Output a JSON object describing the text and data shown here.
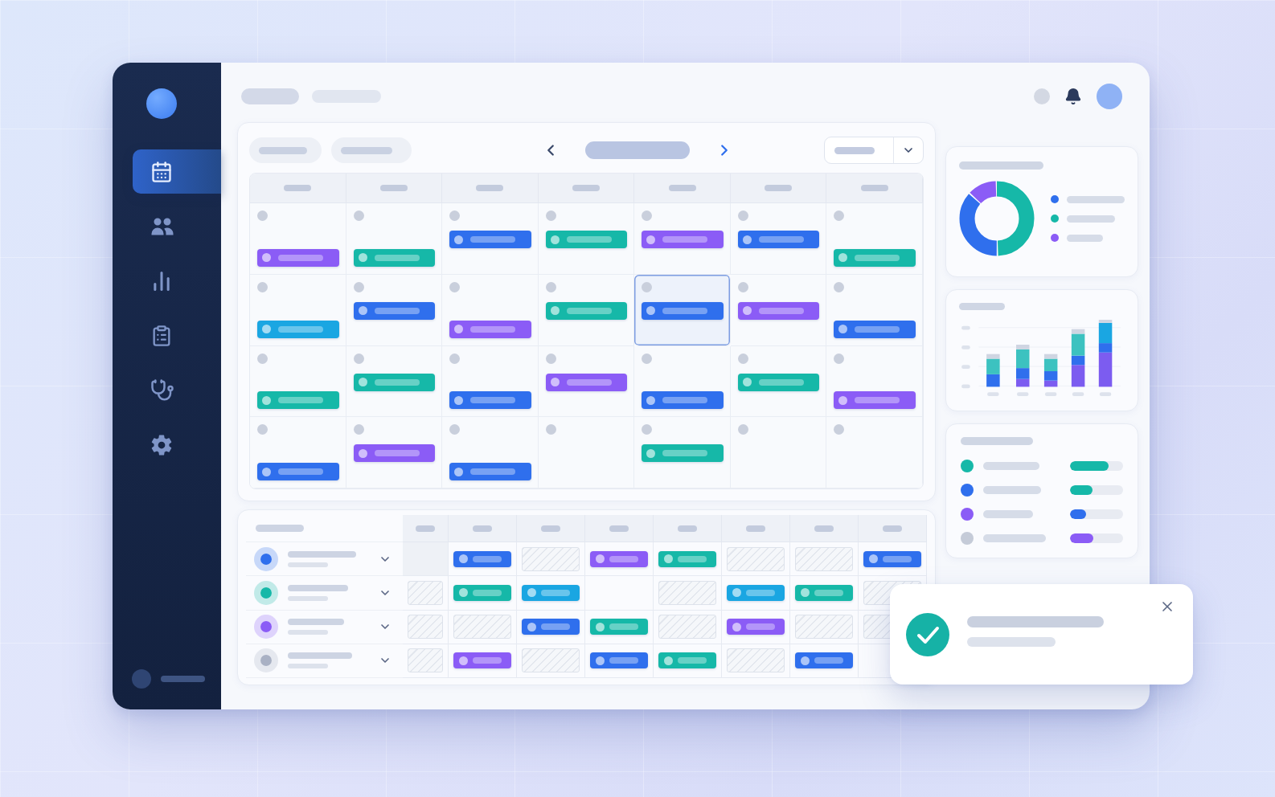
{
  "sidebar": {
    "items": [
      {
        "kind": "calendar",
        "selected": true
      },
      {
        "kind": "people",
        "selected": false
      },
      {
        "kind": "chart",
        "selected": false
      },
      {
        "kind": "clipboard",
        "selected": false
      },
      {
        "kind": "stethoscope",
        "selected": false
      },
      {
        "kind": "settings",
        "selected": false
      }
    ]
  },
  "calendar": {
    "weeks": [
      {
        "days": [
          {
            "selected": false,
            "event": {
              "color": "#8b5cf6",
              "kind": "late"
            }
          },
          {
            "selected": false,
            "event": {
              "color": "#16b8a8",
              "kind": "late"
            }
          },
          {
            "selected": false,
            "event": {
              "color": "#2f6fed",
              "kind": "early"
            }
          },
          {
            "selected": false,
            "event": {
              "color": "#16b8a8",
              "kind": "early"
            }
          },
          {
            "selected": false,
            "event": {
              "color": "#8b5cf6",
              "kind": "early"
            }
          },
          {
            "selected": false,
            "event": {
              "color": "#2f6fed",
              "kind": "early"
            }
          },
          {
            "selected": false,
            "event": {
              "color": "#16b8a8",
              "kind": "late"
            }
          }
        ]
      },
      {
        "days": [
          {
            "selected": false,
            "event": {
              "color": "#1aa6e2",
              "kind": "late"
            }
          },
          {
            "selected": false,
            "event": {
              "color": "#2f6fed",
              "kind": "early"
            }
          },
          {
            "selected": false,
            "event": {
              "color": "#8b5cf6",
              "kind": "late"
            }
          },
          {
            "selected": false,
            "event": {
              "color": "#16b8a8",
              "kind": "early"
            }
          },
          {
            "selected": true,
            "event": {
              "color": "#2f6fed",
              "kind": "early"
            }
          },
          {
            "selected": false,
            "event": {
              "color": "#8b5cf6",
              "kind": "early"
            }
          },
          {
            "selected": false,
            "event": {
              "color": "#2f6fed",
              "kind": "late"
            }
          }
        ]
      },
      {
        "days": [
          {
            "selected": false,
            "event": {
              "color": "#16b8a8",
              "kind": "late"
            }
          },
          {
            "selected": false,
            "event": {
              "color": "#16b8a8",
              "kind": "early"
            }
          },
          {
            "selected": false,
            "event": {
              "color": "#2f6fed",
              "kind": "late"
            }
          },
          {
            "selected": false,
            "event": {
              "color": "#8b5cf6",
              "kind": "early"
            }
          },
          {
            "selected": false,
            "event": {
              "color": "#2f6fed",
              "kind": "late"
            }
          },
          {
            "selected": false,
            "event": {
              "color": "#16b8a8",
              "kind": "early"
            }
          },
          {
            "selected": false,
            "event": {
              "color": "#8b5cf6",
              "kind": "late"
            }
          }
        ]
      },
      {
        "days": [
          {
            "selected": false,
            "event": {
              "color": "#2f6fed",
              "kind": "late"
            }
          },
          {
            "selected": false,
            "event": {
              "color": "#8b5cf6",
              "kind": "early"
            }
          },
          {
            "selected": false,
            "event": {
              "color": "#2f6fed",
              "kind": "late"
            }
          },
          {
            "selected": false
          },
          {
            "selected": false,
            "event": {
              "color": "#16b8a8",
              "kind": "early"
            }
          },
          {
            "selected": false
          },
          {
            "selected": false
          }
        ]
      }
    ]
  },
  "schedule": {
    "rows": [
      {
        "color": "#2f6fed",
        "cells": [
          {
            "kind": "idle"
          },
          {
            "kind": "event",
            "color": "#2f6fed"
          },
          {
            "kind": "blocked"
          },
          {
            "kind": "event",
            "color": "#8b5cf6"
          },
          {
            "kind": "event",
            "color": "#16b8a8"
          },
          {
            "kind": "blocked"
          },
          {
            "kind": "blocked"
          },
          {
            "kind": "event",
            "color": "#2f6fed"
          }
        ]
      },
      {
        "color": "#16b8a8",
        "cells": [
          {
            "kind": "blocked"
          },
          {
            "kind": "event",
            "color": "#16b8a8"
          },
          {
            "kind": "event",
            "color": "#1aa6e2"
          },
          {
            "kind": "empty"
          },
          {
            "kind": "blocked"
          },
          {
            "kind": "event",
            "color": "#1aa6e2"
          },
          {
            "kind": "event",
            "color": "#16b8a8"
          },
          {
            "kind": "blocked"
          }
        ]
      },
      {
        "color": "#8b5cf6",
        "cells": [
          {
            "kind": "blocked"
          },
          {
            "kind": "blocked"
          },
          {
            "kind": "event",
            "color": "#2f6fed"
          },
          {
            "kind": "event",
            "color": "#16b8a8"
          },
          {
            "kind": "blocked"
          },
          {
            "kind": "event",
            "color": "#8b5cf6"
          },
          {
            "kind": "blocked"
          },
          {
            "kind": "blocked"
          }
        ]
      },
      {
        "color": "#a9b1c4",
        "cells": [
          {
            "kind": "blocked"
          },
          {
            "kind": "event",
            "color": "#8b5cf6"
          },
          {
            "kind": "blocked"
          },
          {
            "kind": "event",
            "color": "#2f6fed"
          },
          {
            "kind": "event",
            "color": "#16b8a8"
          },
          {
            "kind": "blocked"
          },
          {
            "kind": "event",
            "color": "#2f6fed"
          },
          {
            "kind": "empty"
          }
        ]
      }
    ]
  },
  "donut_legend": [
    {
      "color": "#2f6fed"
    },
    {
      "color": "#16b8a8"
    },
    {
      "color": "#8b5cf6"
    }
  ],
  "staff": [
    {
      "color": "#16b8a8",
      "meter": {
        "level": 0.72,
        "color": "#16b8a8"
      }
    },
    {
      "color": "#2f6fed",
      "meter": {
        "level": 0.42,
        "color": "#16b8a8"
      }
    },
    {
      "color": "#8b5cf6",
      "meter": {
        "level": 0.3,
        "color": "#2f6fed"
      }
    },
    {
      "color": "#c5cbd8",
      "meter": {
        "level": 0.44,
        "color": "#8b5cf6"
      }
    }
  ],
  "toast": {
    "kind": "success"
  }
}
